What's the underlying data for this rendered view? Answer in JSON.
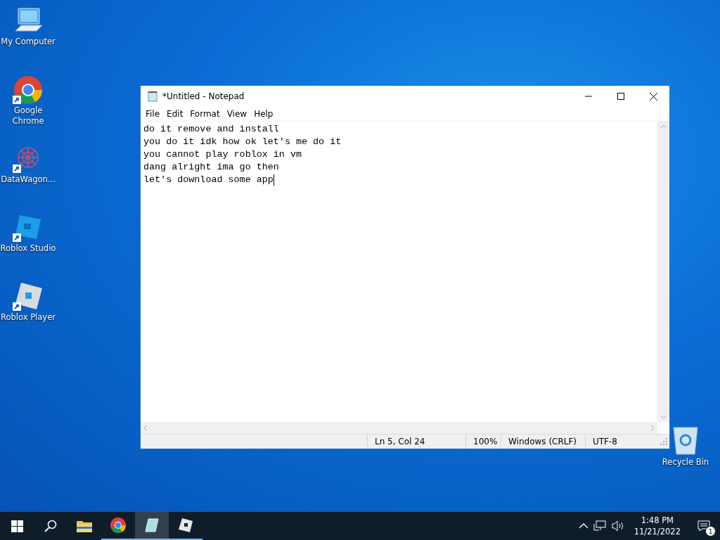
{
  "desktop_icons": [
    {
      "kind": "computer",
      "label": "My Computer",
      "shortcut": false
    },
    {
      "kind": "chrome",
      "label": "Google Chrome",
      "shortcut": true
    },
    {
      "kind": "datawagon",
      "label": "DataWagon...",
      "shortcut": true
    },
    {
      "kind": "studio",
      "label": "Roblox Studio",
      "shortcut": true
    },
    {
      "kind": "player",
      "label": "Roblox Player",
      "shortcut": true
    }
  ],
  "recycle_bin": {
    "label": "Recycle Bin"
  },
  "window": {
    "title": "*Untitled - Notepad",
    "menu": [
      "File",
      "Edit",
      "Format",
      "View",
      "Help"
    ],
    "lines": [
      "do it remove and install",
      "you do it idk how ok let's me do it",
      "you cannot play roblox in vm",
      "dang alright ima go then",
      "let's download some app"
    ],
    "status_bar": {
      "position": "Ln 5, Col 24",
      "zoom": "100%",
      "line_ending": "Windows (CRLF)",
      "encoding": "UTF-8"
    }
  },
  "taskbar": {
    "apps": [
      {
        "kind": "explorer",
        "active": false
      },
      {
        "kind": "chrome",
        "active": false
      },
      {
        "kind": "notepad",
        "active": true
      },
      {
        "kind": "roblox",
        "active": false
      }
    ],
    "time": "1:48 PM",
    "date": "11/21/2022",
    "notification_count": "1"
  }
}
